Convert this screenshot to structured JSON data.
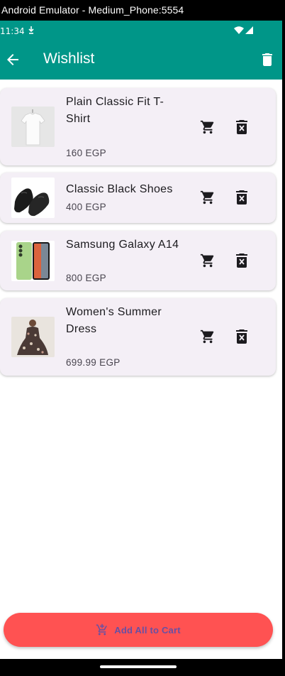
{
  "window": {
    "title": "Android Emulator - Medium_Phone:5554"
  },
  "status_bar": {
    "time": "11:34",
    "icons": [
      "download-icon",
      "wifi-icon",
      "signal-icon"
    ]
  },
  "app_bar": {
    "title": "Wishlist",
    "back_icon": "arrow-back-icon",
    "action_icon": "delete-icon"
  },
  "items": [
    {
      "name": "Plain Classic Fit T-Shirt",
      "price": "160 EGP",
      "image": "white-tshirt"
    },
    {
      "name": "Classic Black Shoes",
      "price": "400 EGP",
      "image": "black-shoes"
    },
    {
      "name": "Samsung Galaxy A14",
      "price": "800 EGP",
      "image": "samsung-phone"
    },
    {
      "name": "Women's Summer Dress",
      "price": "699.99 EGP",
      "image": "floral-dress"
    }
  ],
  "footer": {
    "add_all_label": "Add All to Cart",
    "add_all_icon": "add-shopping-cart-icon"
  },
  "colors": {
    "app_bar": "#009688",
    "card_background": "#f4eff6",
    "add_all_button": "#ff5252",
    "add_all_text": "#6750a4"
  }
}
